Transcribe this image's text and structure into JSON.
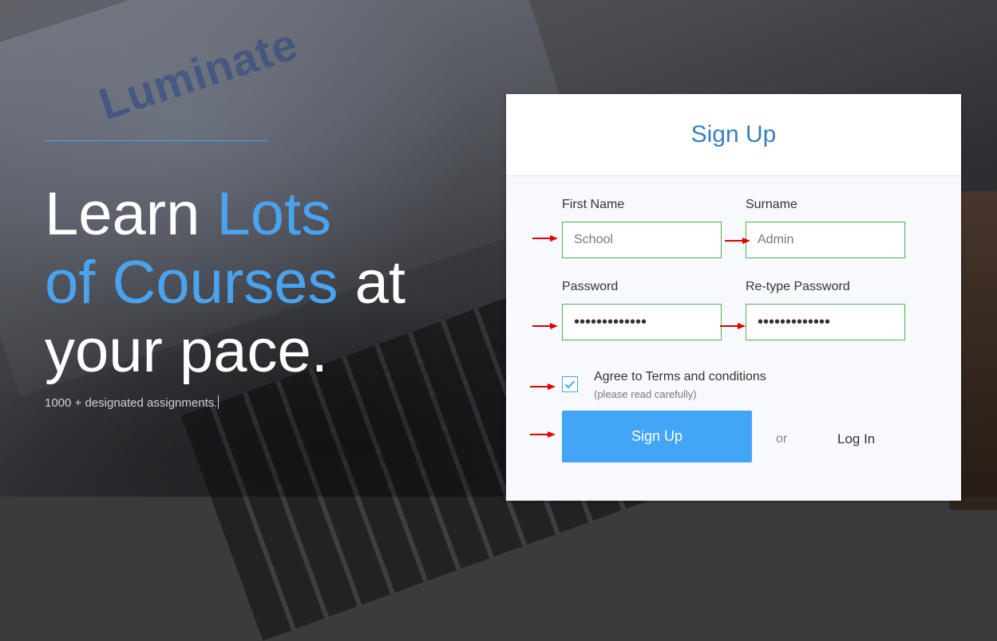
{
  "hero": {
    "title_part1": "Learn ",
    "title_accent1": "Lots",
    "title_accent2": "of Courses",
    "title_part2": " at",
    "title_part3": "your pace.",
    "subtitle": "1000 + designated assignments."
  },
  "background": {
    "logo_text": "Luminate"
  },
  "signup_form": {
    "title": "Sign Up",
    "first_name": {
      "label": "First Name",
      "placeholder": "School"
    },
    "surname": {
      "label": "Surname",
      "placeholder": "Admin"
    },
    "password": {
      "label": "Password",
      "value": "•••••••••••••"
    },
    "retype_password": {
      "label": "Re-type Password",
      "value": "•••••••••••••"
    },
    "terms": {
      "label": "Agree to Terms and conditions",
      "note": "(please read carefully)",
      "checked": true
    },
    "submit_label": "Sign Up",
    "or_text": "or",
    "login_label": "Log In"
  },
  "colors": {
    "accent": "#42a5f5",
    "title_blue": "#3a7fc0",
    "field_border": "#4caf50",
    "arrow": "#e00000"
  },
  "icons": {
    "checkbox": "check-icon",
    "annotation": "red-arrow-icon"
  }
}
